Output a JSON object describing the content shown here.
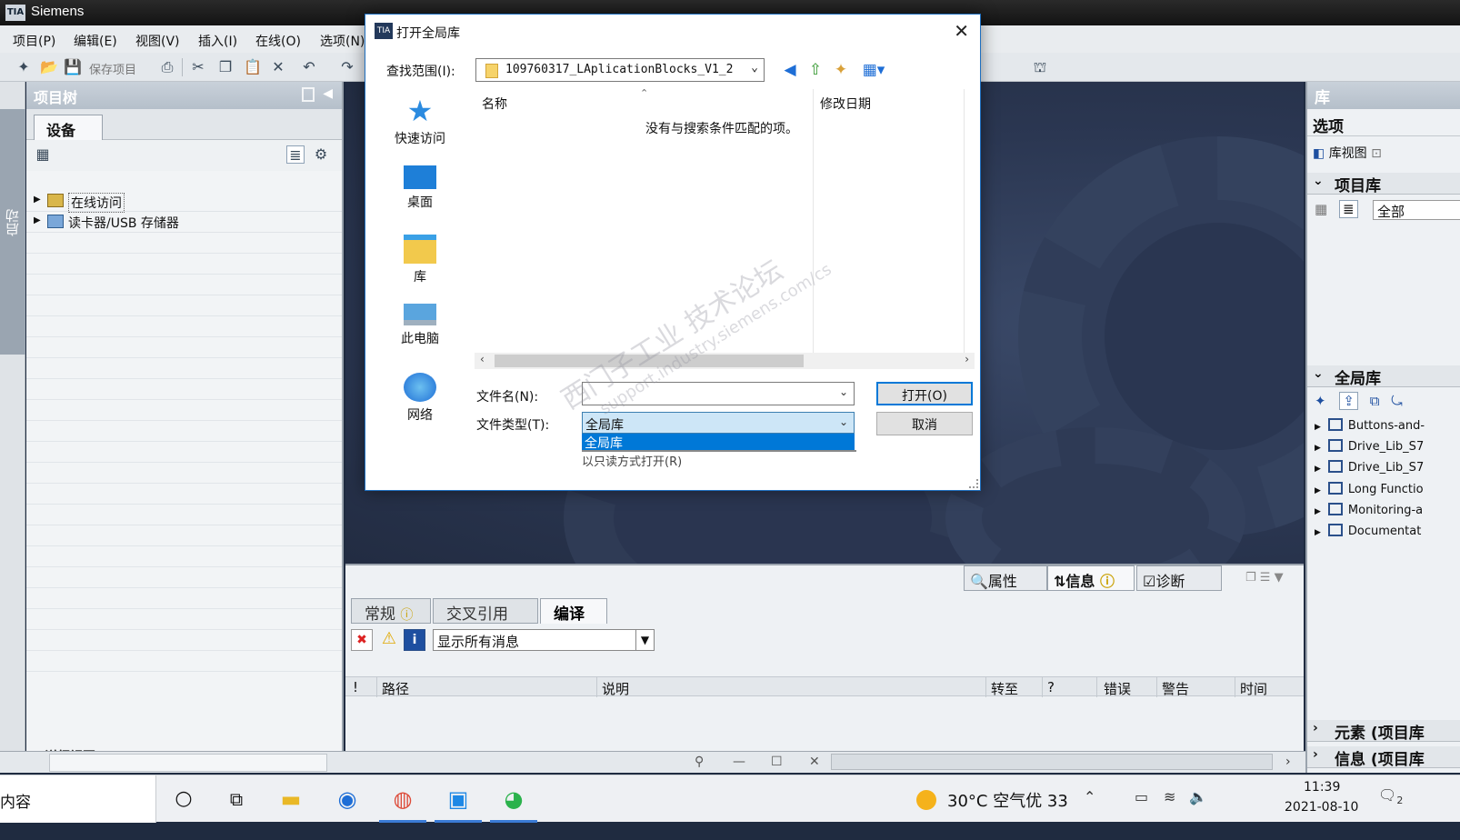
{
  "app": {
    "logo": "TIA",
    "title": "Siemens"
  },
  "menu": [
    "项目(P)",
    "编辑(E)",
    "视图(V)",
    "插入(I)",
    "在线(O)",
    "选项(N)"
  ],
  "toolbar": {
    "save_project": "保存项目"
  },
  "left_strip": {
    "start_label": "启动"
  },
  "project_tree": {
    "title": "项目树",
    "tab": "设备",
    "items": [
      {
        "label": "在线访问",
        "selected": true
      },
      {
        "label": "读卡器/USB 存储器",
        "selected": false
      }
    ],
    "detail_view_label": "详细视图"
  },
  "library": {
    "title": "库",
    "options": "选项",
    "library_view": "库视图",
    "project_library": "项目库",
    "filter_value": "全部",
    "global_library": "全局库",
    "global_items": [
      "Buttons-and-",
      "Drive_Lib_S7",
      "Drive_Lib_S7",
      "Long Functio",
      "Monitoring-a",
      "Documentat"
    ],
    "elements_section": "元素 (项目库",
    "info_section": "信息 (项目库"
  },
  "inspector": {
    "tabs": [
      "属性",
      "信息",
      "诊断"
    ],
    "subtabs": [
      "常规",
      "交叉引用",
      "编译"
    ],
    "active_subtab": "编译",
    "filter": "显示所有消息",
    "columns": [
      "!",
      "路径",
      "说明",
      "转至",
      "?",
      "错误",
      "警告",
      "时间"
    ]
  },
  "dialog": {
    "logo": "TIA",
    "title": "打开全局库",
    "look_in_label": "查找范围(I):",
    "look_in_value": "109760317_LAplicationBlocks_V1_2",
    "places": [
      "快速访问",
      "桌面",
      "库",
      "此电脑",
      "网络"
    ],
    "columns": {
      "name": "名称",
      "modified": "修改日期"
    },
    "empty_message": "没有与搜索条件匹配的项。",
    "filename_label": "文件名(N):",
    "filename_value": "",
    "filetype_label": "文件类型(T):",
    "filetype_value": "全局库",
    "dropdown_option": "全局库",
    "readonly_text": "以只读方式打开(R)",
    "open_button": "打开(O)",
    "cancel_button": "取消"
  },
  "watermark": {
    "line1": "西门子工业 技术论坛",
    "line2": "support.industry.siemens.com/cs"
  },
  "taskbar": {
    "search_text": "内容",
    "weather": "30°C 空气优 33",
    "time": "11:39",
    "date": "2021-08-10",
    "notification_count": "2"
  },
  "colors": {
    "accent": "#0078d7",
    "workspace": "#2b3752",
    "tia_header": "#b5bfca"
  }
}
